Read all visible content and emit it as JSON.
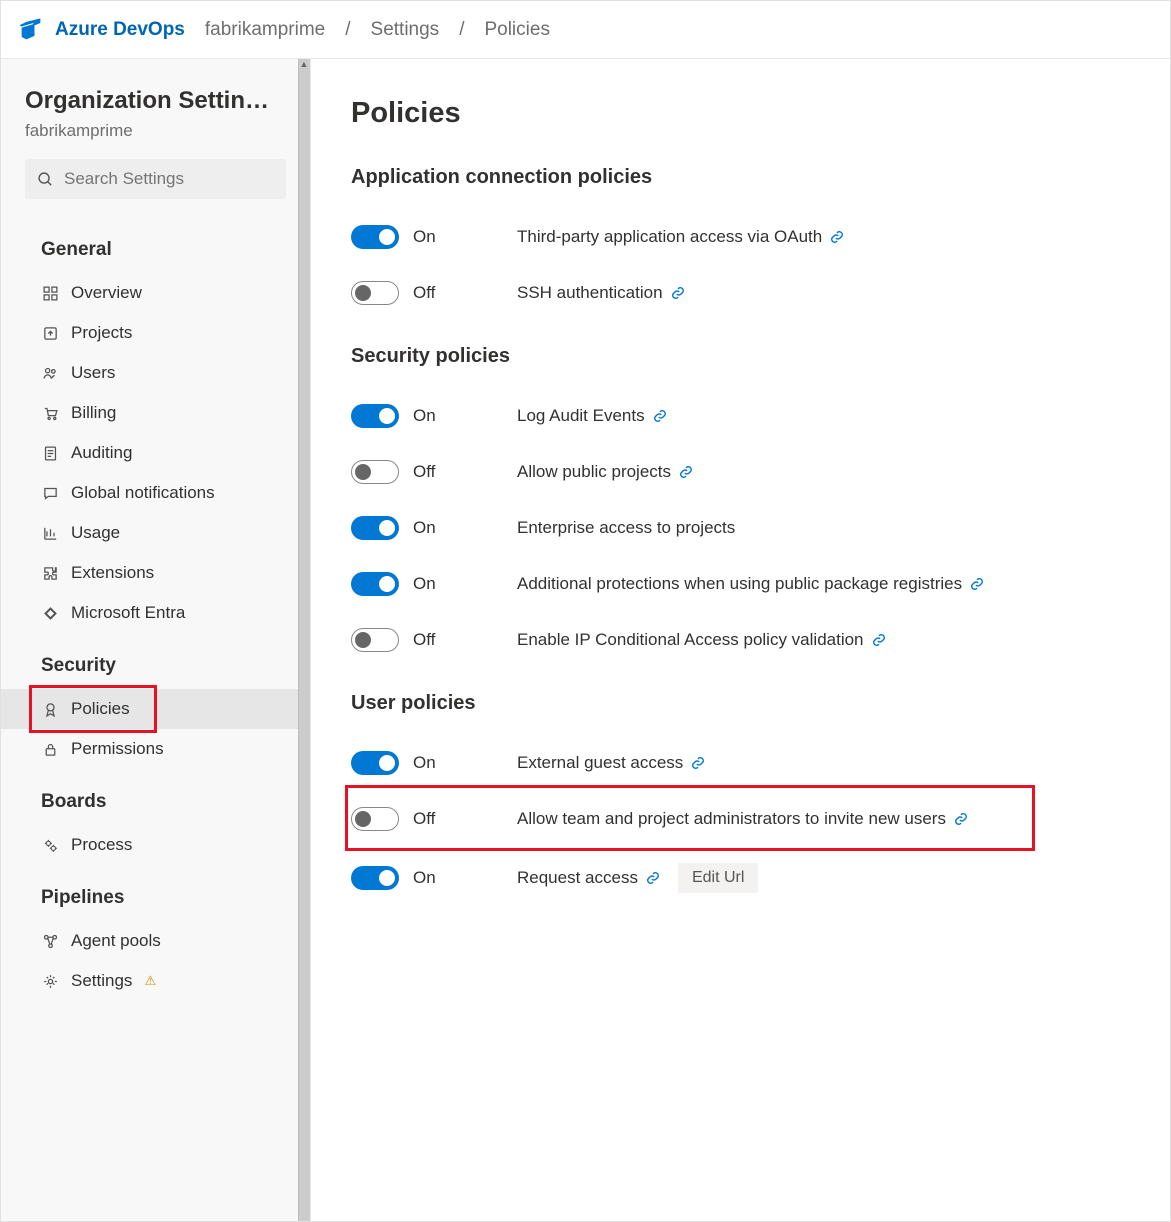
{
  "header": {
    "brand": "Azure DevOps",
    "crumbs": [
      "fabrikamprime",
      "Settings",
      "Policies"
    ]
  },
  "sidebar": {
    "title": "Organization Settin…",
    "subtitle": "fabrikamprime",
    "search_placeholder": "Search Settings",
    "groups": [
      {
        "title": "General",
        "items": [
          {
            "label": "Overview",
            "icon": "grid"
          },
          {
            "label": "Projects",
            "icon": "up-box"
          },
          {
            "label": "Users",
            "icon": "people"
          },
          {
            "label": "Billing",
            "icon": "cart"
          },
          {
            "label": "Auditing",
            "icon": "doc"
          },
          {
            "label": "Global notifications",
            "icon": "chat"
          },
          {
            "label": "Usage",
            "icon": "chart"
          },
          {
            "label": "Extensions",
            "icon": "puzzle"
          },
          {
            "label": "Microsoft Entra",
            "icon": "diamond"
          }
        ]
      },
      {
        "title": "Security",
        "items": [
          {
            "label": "Policies",
            "icon": "badge",
            "active": true,
            "highlight": true
          },
          {
            "label": "Permissions",
            "icon": "lock"
          }
        ]
      },
      {
        "title": "Boards",
        "items": [
          {
            "label": "Process",
            "icon": "gears"
          }
        ]
      },
      {
        "title": "Pipelines",
        "items": [
          {
            "label": "Agent pools",
            "icon": "nodes"
          },
          {
            "label": "Settings",
            "icon": "gear",
            "warn": true
          }
        ]
      }
    ]
  },
  "main": {
    "title": "Policies",
    "sections": [
      {
        "title": "Application connection policies",
        "policies": [
          {
            "on": true,
            "state": "On",
            "label": "Third-party application access via OAuth",
            "link": true
          },
          {
            "on": false,
            "state": "Off",
            "label": "SSH authentication",
            "link": true
          }
        ]
      },
      {
        "title": "Security policies",
        "policies": [
          {
            "on": true,
            "state": "On",
            "label": "Log Audit Events",
            "link": true
          },
          {
            "on": false,
            "state": "Off",
            "label": "Allow public projects",
            "link": true
          },
          {
            "on": true,
            "state": "On",
            "label": "Enterprise access to projects",
            "link": false
          },
          {
            "on": true,
            "state": "On",
            "label": "Additional protections when using public package registries",
            "link": true
          },
          {
            "on": false,
            "state": "Off",
            "label": "Enable IP Conditional Access policy validation",
            "link": true
          }
        ]
      },
      {
        "title": "User policies",
        "policies": [
          {
            "on": true,
            "state": "On",
            "label": "External guest access",
            "link": true
          },
          {
            "on": false,
            "state": "Off",
            "label": "Allow team and project administrators to invite new users",
            "link": true,
            "highlight": true
          },
          {
            "on": true,
            "state": "On",
            "label": "Request access",
            "link": true,
            "edit": "Edit Url"
          }
        ]
      }
    ]
  }
}
